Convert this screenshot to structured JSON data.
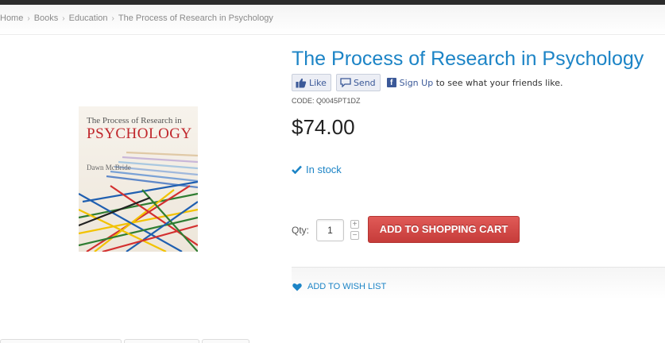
{
  "breadcrumb": {
    "items": [
      "Home",
      "Books",
      "Education",
      "The Process of Research in Psychology"
    ],
    "separator_icon": "chevron-right-icon"
  },
  "product": {
    "title": "The Process of Research in Psychology",
    "code": "CODE: Q0045PT1DZ",
    "price": "$74.00",
    "stock_status": "In stock",
    "cover": {
      "title_line1": "The Process of Research in",
      "title_line2": "PSYCHOLOGY",
      "author": "Dawn McBride"
    }
  },
  "social": {
    "like_label": "Like",
    "send_label": "Send",
    "signup_link": "Sign Up",
    "signup_text": "to see what your friends like."
  },
  "purchase": {
    "qty_label": "Qty:",
    "qty_value": "1",
    "increment_symbol": "+",
    "decrement_symbol": "−",
    "add_to_cart_label": "ADD TO SHOPPING CART"
  },
  "wishlist": {
    "label": "ADD TO WISH LIST"
  },
  "colors": {
    "accent": "#1c84c6",
    "cart_button": "#d24a47",
    "facebook": "#3b5998"
  }
}
